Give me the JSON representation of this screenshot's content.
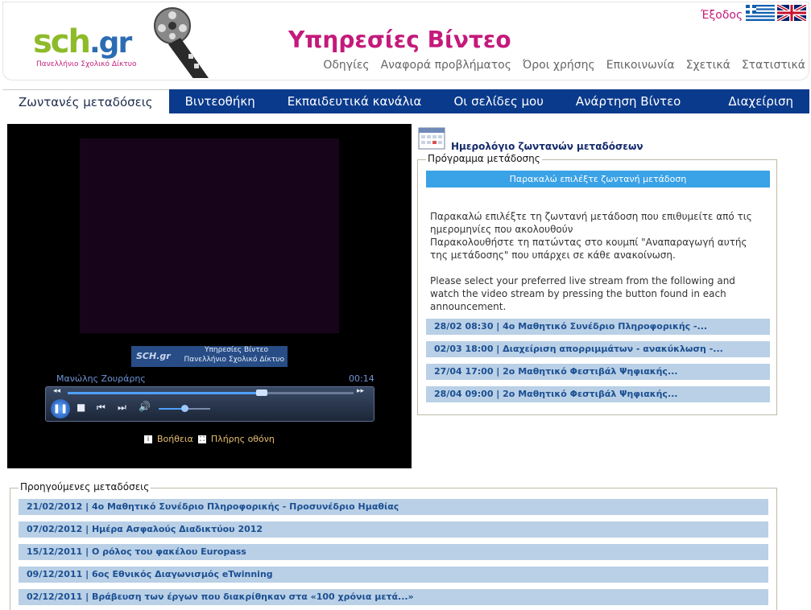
{
  "header": {
    "logo_text_sch": "sch",
    "logo_text_gr": ".gr",
    "logo_subtitle": "Πανελλήνιο Σχολικό Δίκτυο",
    "site_title": "Υπηρεσίες Βίντεο",
    "exit_label": "Έξοδος",
    "top_links": [
      "Οδηγίες",
      "Αναφορά προβλήματος",
      "Όροι χρήσης",
      "Επικοινωνία",
      "Σχετικά",
      "Στατιστικά"
    ]
  },
  "tabs": [
    {
      "label": "Ζωντανές μεταδόσεις",
      "active": true
    },
    {
      "label": "Βιντεοθήκη",
      "active": false
    },
    {
      "label": "Εκπαιδευτικά κανάλια",
      "active": false
    },
    {
      "label": "Οι σελίδες μου",
      "active": false
    },
    {
      "label": "Ανάρτηση Βίντεο",
      "active": false
    },
    {
      "label": "Διαχείριση",
      "active": false
    }
  ],
  "player": {
    "watermark_logo": "SCH.gr",
    "watermark_line1": "Υπηρεσίες Βίντεο",
    "watermark_line2": "Πανελλήνιο Σχολικό Δίκτυο",
    "author": "Μανώλης Ζουράρης",
    "time": "00:14",
    "seek_fraction": 0.68,
    "volume_fraction": 0.5,
    "help_label": "Βοήθεια",
    "fullscreen_label": "Πλήρης οθόνη"
  },
  "calendar": {
    "title": "Ημερολόγιο ζωντανών μεταδόσεων",
    "legend": "Πρόγραμμα μετάδοσης",
    "select_prompt": "Παρακαλώ επιλέξτε ζωντανή μετάδοση",
    "info_gr_1": "Παρακαλώ επιλέξτε τη ζωντανή μετάδοση που επιθυμείτε από τις ημερομηνίες που ακολουθούν",
    "info_gr_2": "Παρακολουθήστε τη πατώντας στο κουμπί \"Αναπαραγωγή αυτής της μετάδοσης\" που υπάρχει σε κάθε ανακοίνωση.",
    "info_en": "Please select your preferred live stream from the following and watch the video stream by pressing the button found in each announcement.",
    "items": [
      "28/02 08:30 | 4ο Μαθητικό Συνέδριο Πληροφορικής -...",
      "02/03 18:00 | Διαχείριση απορριμμάτων - ανακύκλωση -...",
      "27/04 17:00 | 2ο Μαθητικό Φεστιβάλ Ψηφιακής...",
      "28/04 09:00 | 2ο Μαθητικό Φεστιβάλ Ψηφιακής..."
    ]
  },
  "previous": {
    "legend": "Προηγούμενες μεταδόσεις",
    "items": [
      "21/02/2012 | 4ο Μαθητικό Συνέδριο Πληροφορικής - Προσυνέδριο Ημαθίας",
      "07/02/2012 | Ημέρα Ασφαλούς Διαδικτύου 2012",
      "15/12/2011 | Ο ρόλος του φακέλου Europass",
      "09/12/2011 | 6ος Εθνικός Διαγωνισμός eTwinning",
      "02/12/2011 | Βράβευση των έργων που διακρίθηκαν στα «100 χρόνια μετά...»"
    ]
  }
}
